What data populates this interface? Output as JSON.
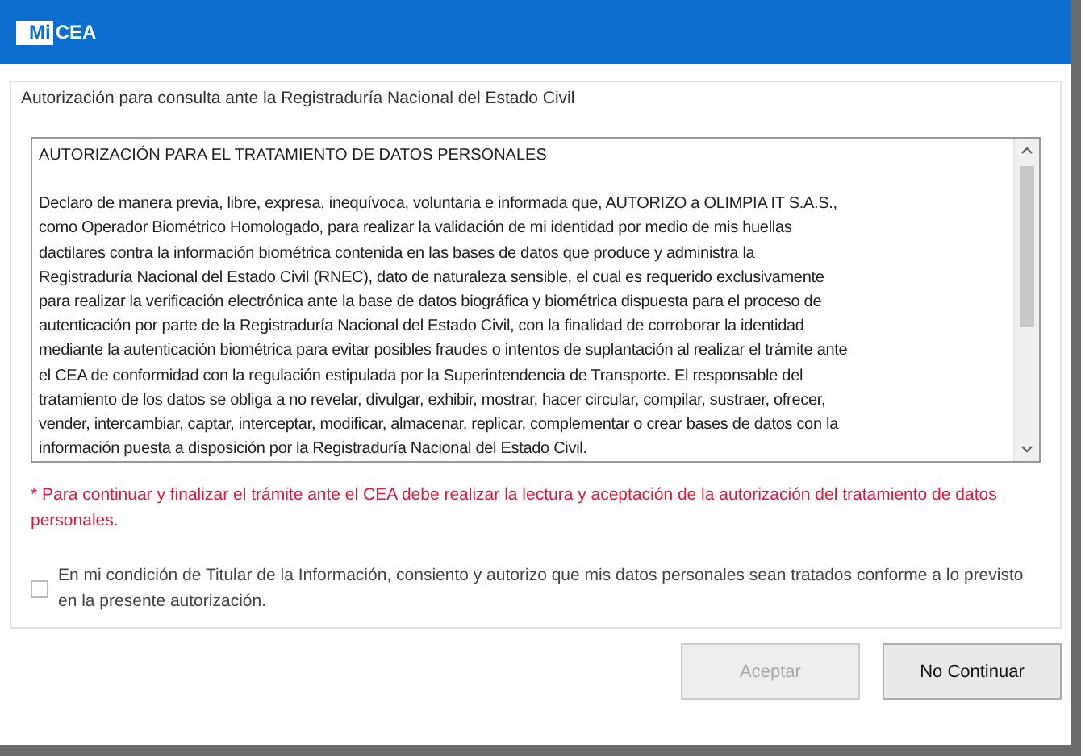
{
  "header": {
    "logo_box": "Mi",
    "logo_text": "CEA"
  },
  "panel": {
    "legend": "Autorización para consulta ante la Registraduría Nacional del Estado Civil",
    "document": {
      "heading": "AUTORIZACIÓN PARA EL TRATAMIENTO DE DATOS PERSONALES",
      "paragraph": "Declaro de manera previa, libre, expresa, inequívoca, voluntaria e informada que, AUTORIZO a OLIMPIA IT S.A.S.,\ncomo Operador Biométrico Homologado, para realizar la validación de mi identidad por medio de mis huellas\ndactilares contra la información biométrica contenida en las bases de datos que produce y administra la\nRegistraduría Nacional del Estado Civil (RNEC), dato de naturaleza sensible, el cual es requerido exclusivamente\npara realizar la verificación electrónica ante la base de datos biográfica y biométrica dispuesta para el proceso de\nautenticación por parte de la Registraduría Nacional del Estado Civil, con la finalidad de corroborar la identidad\nmediante la autenticación biométrica para evitar posibles fraudes o intentos de suplantación al realizar el trámite ante\nel CEA de conformidad con la regulación estipulada por la Superintendencia de Transporte. El responsable del\ntratamiento de los datos se obliga a no revelar, divulgar, exhibir, mostrar, hacer circular, compilar, sustraer, ofrecer,\nvender, intercambiar, captar, interceptar, modificar, almacenar, replicar, complementar o crear bases de datos con la\ninformación puesta a disposición por la Registraduría Nacional del Estado Civil."
    },
    "notice": "* Para continuar y finalizar el trámite ante el CEA debe realizar la lectura y aceptación de la autorización del tratamiento de datos personales.",
    "consent": {
      "label": "En mi condición de Titular de la Información, consiento y autorizo que mis datos personales sean tratados conforme a lo previsto en la presente autorización.",
      "checked": false
    }
  },
  "buttons": [
    {
      "label": "Aceptar",
      "disabled": true
    },
    {
      "label": "No Continuar",
      "disabled": false
    }
  ]
}
